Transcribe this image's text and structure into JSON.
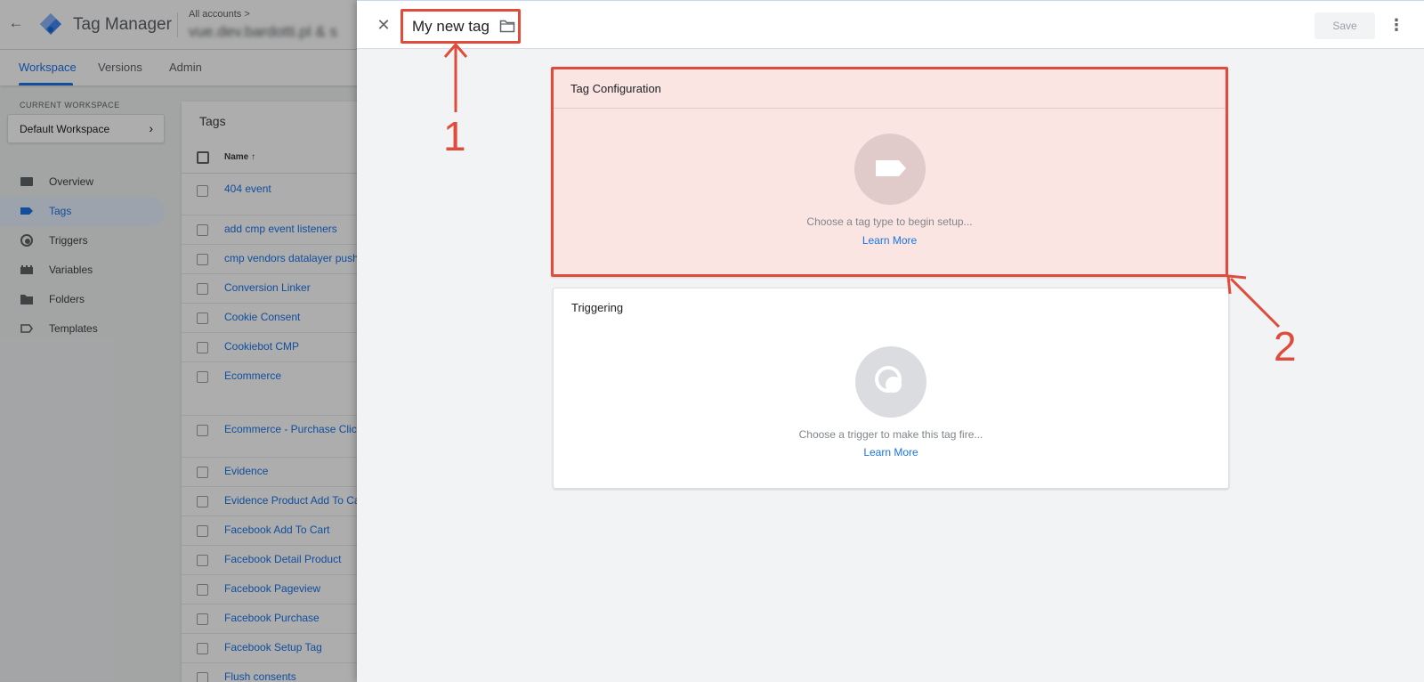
{
  "background_app": {
    "app_name": "Tag Manager",
    "breadcrumb": "All accounts >",
    "container_name": "vue.dev.bardotti.pl & s",
    "subnav": {
      "workspace": "Workspace",
      "versions": "Versions",
      "admin": "Admin"
    },
    "current_workspace_label": "CURRENT WORKSPACE",
    "workspace_name": "Default Workspace",
    "nav": [
      "Overview",
      "Tags",
      "Triggers",
      "Variables",
      "Folders",
      "Templates"
    ],
    "tags_title": "Tags",
    "tags_name_header": "Name ↑",
    "tags": [
      "404 event",
      "add cmp event listeners",
      "cmp vendors datalayer push",
      "Conversion Linker",
      "Cookie Consent",
      "Cookiebot CMP",
      "Ecommerce",
      "Ecommerce - Purchase Click",
      "Evidence",
      "Evidence Product Add To Cart",
      "Facebook Add To Cart",
      "Facebook Detail Product",
      "Facebook Pageview",
      "Facebook Purchase",
      "Facebook Setup Tag",
      "Flush consents"
    ]
  },
  "panel": {
    "tag_title": "My new tag",
    "save_label": "Save",
    "tag_configuration": {
      "title": "Tag Configuration",
      "placeholder": "Choose a tag type to begin setup...",
      "learn_more": "Learn More"
    },
    "triggering": {
      "title": "Triggering",
      "placeholder": "Choose a trigger to make this tag fire...",
      "learn_more": "Learn More"
    }
  },
  "annotations": {
    "label_1": "1",
    "label_2": "2",
    "color": "#e04b3c"
  },
  "colors": {
    "accent": "#1a73e8",
    "annotation": "#e04b3c",
    "highlight_fill": "#fbe5e3"
  },
  "icons": {
    "close": "close-icon",
    "folder": "folder-icon",
    "more": "more-vert-icon",
    "tag": "tag-icon",
    "trigger": "trigger-icon"
  }
}
